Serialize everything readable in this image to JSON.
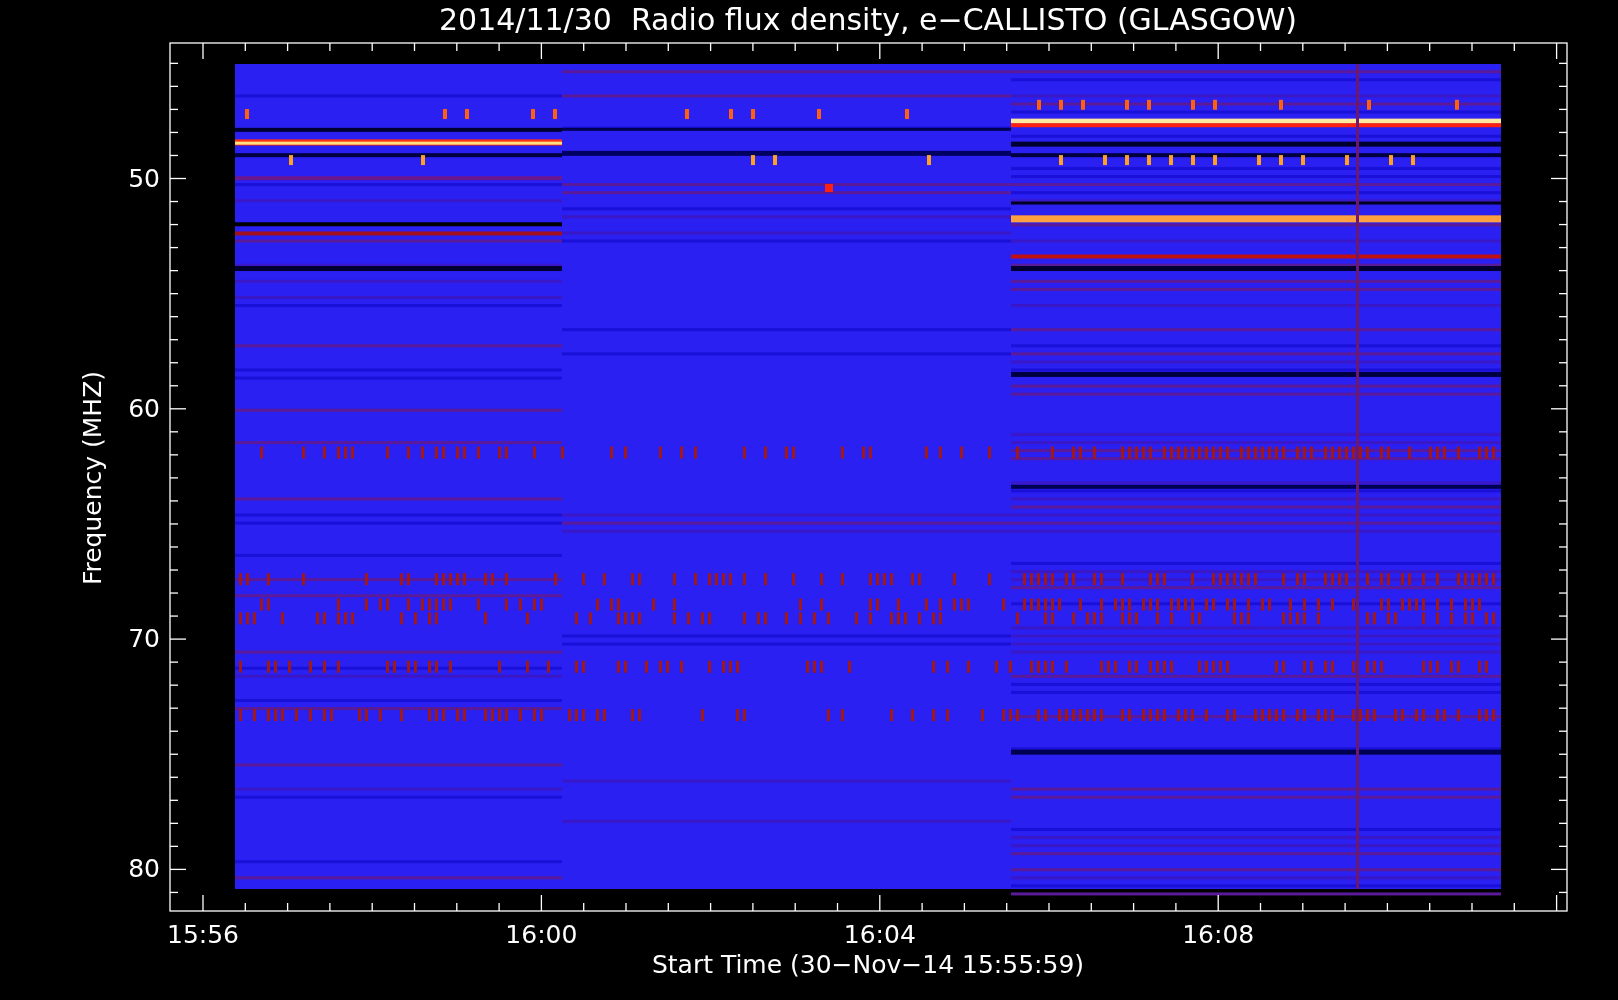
{
  "title": "2014/11/30  Radio flux density, e−CALLISTO (GLASGOW)",
  "y_axis": {
    "label": "Frequency (MHZ)",
    "ticks": [
      "50",
      "60",
      "70",
      "80"
    ]
  },
  "x_axis": {
    "label": "Start Time (30−Nov−14 15:55:59)",
    "ticks": [
      "15:56",
      "16:00",
      "16:04",
      "16:08"
    ]
  }
}
